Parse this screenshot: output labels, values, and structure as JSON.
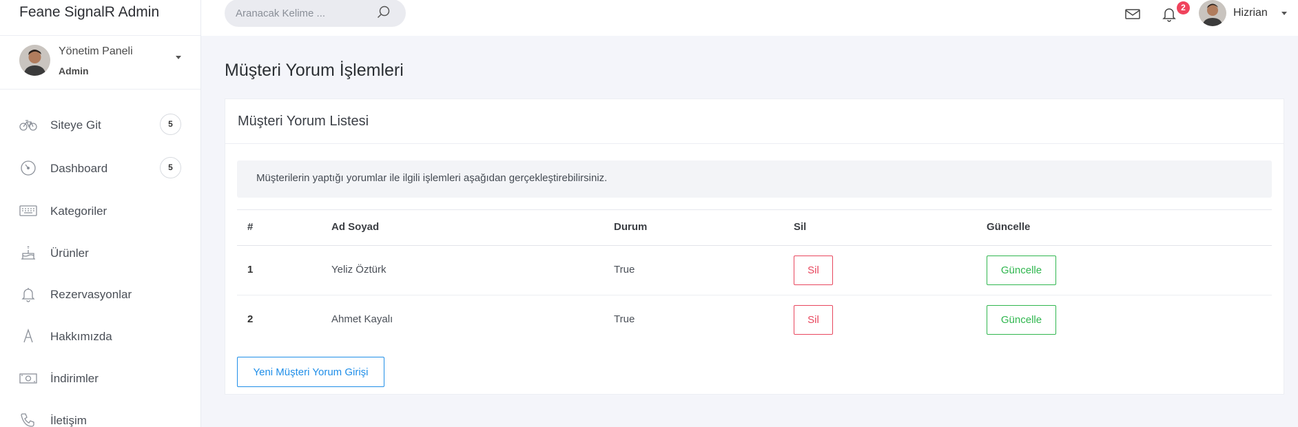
{
  "app": {
    "brand": "Feane SignalR Admin"
  },
  "profile": {
    "name": "Yönetim Paneli",
    "role": "Admin"
  },
  "sidebar": {
    "items": [
      {
        "label": "Siteye Git",
        "icon": "bicycle-icon",
        "badge": "5"
      },
      {
        "label": "Dashboard",
        "icon": "speedometer-icon",
        "badge": "5"
      },
      {
        "label": "Kategoriler",
        "icon": "keyboard-icon",
        "badge": null
      },
      {
        "label": "Ürünler",
        "icon": "cake-icon",
        "badge": null
      },
      {
        "label": "Rezervasyonlar",
        "icon": "bell-icon",
        "badge": null
      },
      {
        "label": "Hakkımızda",
        "icon": "letter-a-icon",
        "badge": null
      },
      {
        "label": "İndirimler",
        "icon": "money-icon",
        "badge": null
      },
      {
        "label": "İletişim",
        "icon": "phone-icon",
        "badge": null
      }
    ]
  },
  "topbar": {
    "search_placeholder": "Aranacak Kelime ...",
    "notification_count": "2",
    "user_name": "Hizrian"
  },
  "page": {
    "title": "Müşteri Yorum İşlemleri",
    "card_title": "Müşteri Yorum Listesi",
    "info_text": "Müşterilerin yaptığı yorumlar ile ilgili işlemleri aşağıdan gerçekleştirebilirsiniz.",
    "new_button": "Yeni Müşteri Yorum Girişi"
  },
  "table": {
    "headers": [
      "#",
      "Ad Soyad",
      "Durum",
      "Sil",
      "Güncelle"
    ],
    "rows": [
      {
        "num": "1",
        "name": "Yeliz Öztürk",
        "status": "True",
        "delete": "Sil",
        "update": "Güncelle"
      },
      {
        "num": "2",
        "name": "Ahmet Kayalı",
        "status": "True",
        "delete": "Sil",
        "update": "Güncelle"
      }
    ]
  },
  "colors": {
    "danger": "#e8465d",
    "success": "#2fb64e",
    "primary": "#1f8ee8",
    "badge": "#f0435c"
  }
}
